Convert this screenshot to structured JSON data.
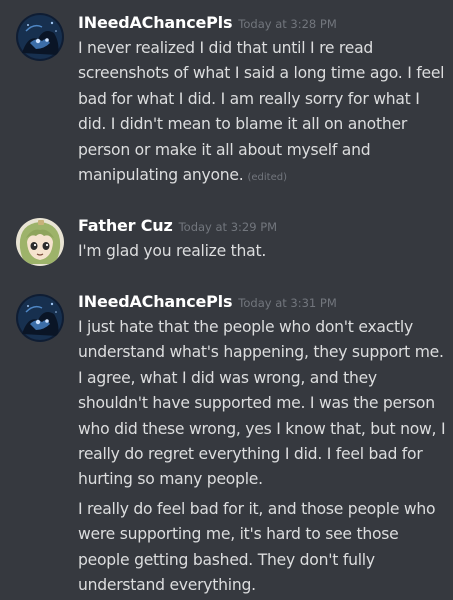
{
  "messages": [
    {
      "author": "INeedAChancePls",
      "timestamp": "Today at 3:28 PM",
      "avatar_icon": "dark-blue-creature-avatar",
      "paragraphs": [
        "I never realized I did that until I re read screenshots of what I said a long time ago. I feel bad for what I did. I am really sorry for what I did. I didn't mean to blame it all on another person or make it all about myself and manipulating anyone."
      ],
      "edited_label": "(edited)"
    },
    {
      "author": "Father Cuz",
      "timestamp": "Today at 3:29 PM",
      "avatar_icon": "anime-girl-avatar",
      "paragraphs": [
        "I'm glad you realize that."
      ]
    },
    {
      "author": "INeedAChancePls",
      "timestamp": "Today at 3:31 PM",
      "avatar_icon": "dark-blue-creature-avatar",
      "paragraphs": [
        "I just hate that the people who don't exactly understand what's happening, they support me. I agree, what I did was wrong, and they shouldn't have supported me. I was the person who did these wrong, yes I know that, but now, I really do regret everything I did. I feel bad for hurting so many people.",
        "I really do feel bad for it, and those people who were supporting me, it's hard to see those people getting bashed. They don't fully understand everything."
      ]
    }
  ],
  "colors": {
    "background": "#36393f",
    "author": "#ffffff",
    "message_text": "#dcddde",
    "timestamp": "#72767d"
  }
}
